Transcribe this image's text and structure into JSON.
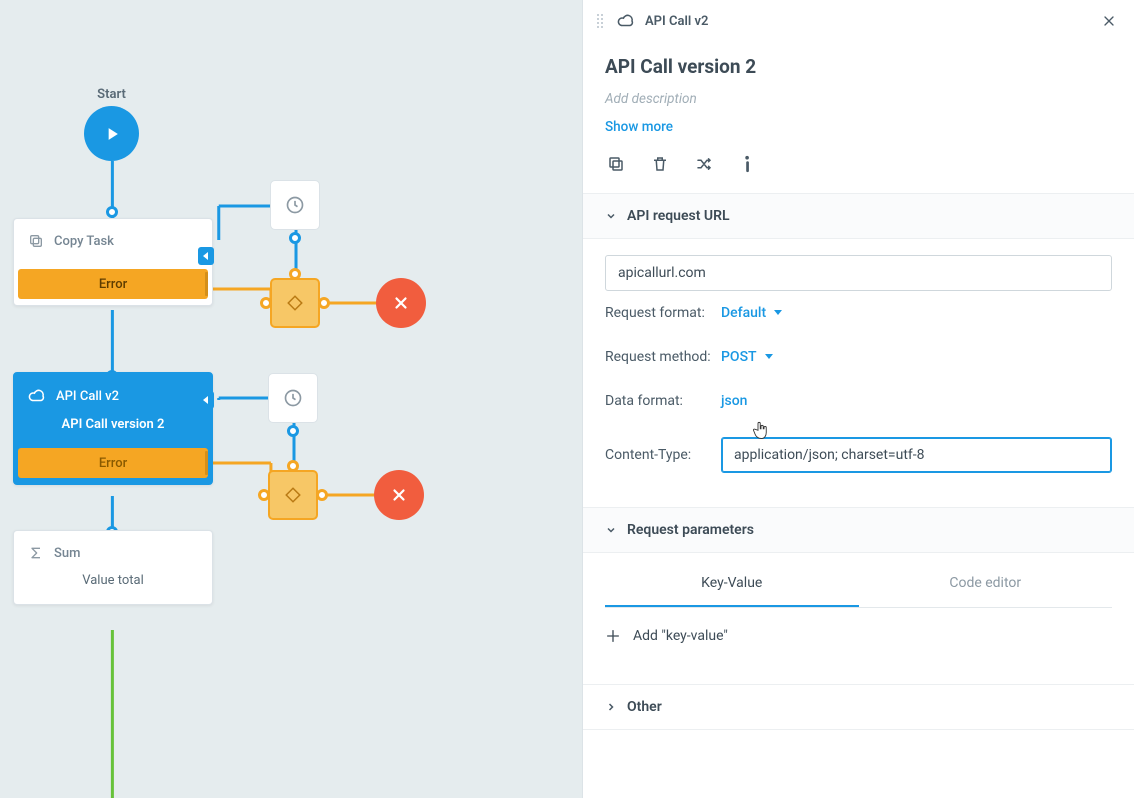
{
  "canvas": {
    "start_label": "Start",
    "nodes": {
      "copy_task": {
        "title": "Copy Task",
        "error": "Error"
      },
      "api_call": {
        "title": "API Call v2",
        "subtitle": "API Call version 2",
        "error": "Error"
      },
      "sum": {
        "title": "Sum",
        "subtitle": "Value total"
      }
    }
  },
  "panel": {
    "header_title": "API Call v2",
    "title": "API Call version 2",
    "description_placeholder": "Add description",
    "show_more": "Show more",
    "sections": {
      "api_url": {
        "label": "API request URL",
        "url_value": "apicallurl.com",
        "rows": {
          "request_format": {
            "label": "Request format:",
            "value": "Default"
          },
          "request_method": {
            "label": "Request method:",
            "value": "POST"
          },
          "data_format": {
            "label": "Data format:",
            "value": "json"
          },
          "content_type": {
            "label": "Content-Type:",
            "value": "application/json; charset=utf-8"
          }
        }
      },
      "request_params": {
        "label": "Request parameters",
        "tabs": {
          "kv": "Key-Value",
          "code": "Code editor"
        },
        "add_kv": "Add \"key-value\""
      },
      "other": {
        "label": "Other"
      }
    }
  }
}
